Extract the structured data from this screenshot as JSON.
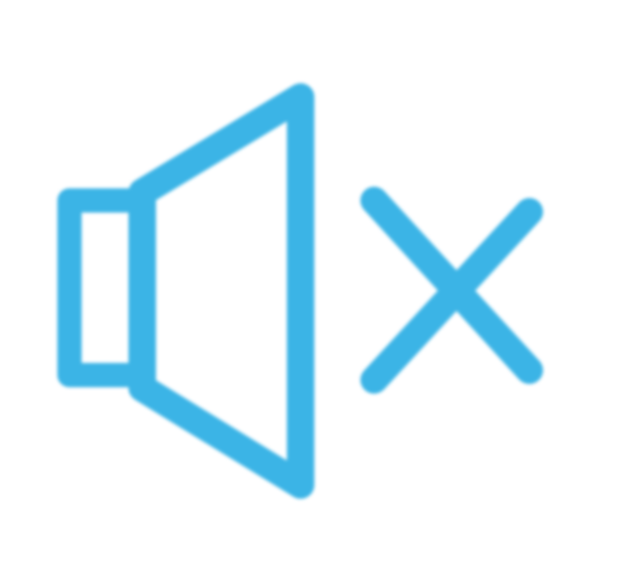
{
  "mute_button": {
    "icon": "speaker-muted-icon",
    "color": "#3bb4e6"
  }
}
